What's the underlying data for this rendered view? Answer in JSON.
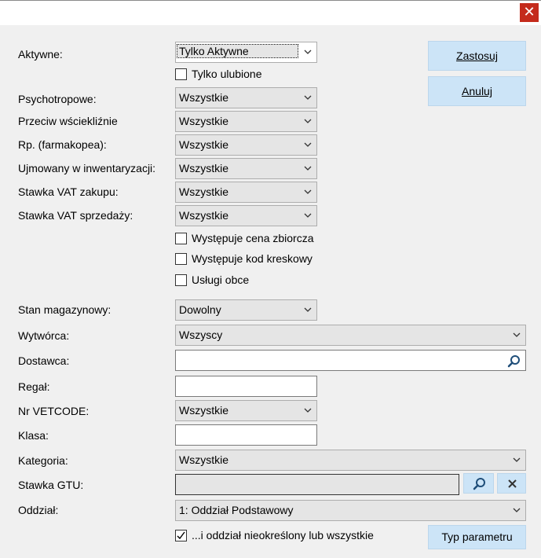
{
  "window": {
    "close_glyph": "✕"
  },
  "filters": {
    "aktywne": {
      "label": "Aktywne:",
      "value": "Tylko Aktywne"
    },
    "tylko_ulubione": {
      "label": "Tylko ulubione",
      "checked": false
    },
    "psychotropowe": {
      "label": "Psychotropowe:",
      "value": "Wszystkie"
    },
    "przeciw_wscieklizn": {
      "label": "Przeciw wściekliźnie",
      "value": "Wszystkie"
    },
    "rp_farmakopea": {
      "label": "Rp. (farmakopea):",
      "value": "Wszystkie"
    },
    "inwentaryzacja": {
      "label": "Ujmowany w inwentaryzacji:",
      "value": "Wszystkie"
    },
    "vat_zakupu": {
      "label": "Stawka VAT zakupu:",
      "value": "Wszystkie"
    },
    "vat_sprzedazy": {
      "label": "Stawka VAT sprzedaży:",
      "value": "Wszystkie"
    },
    "cena_zbiorcza": {
      "label": "Występuje cena zbiorcza",
      "checked": false
    },
    "kod_kreskowy": {
      "label": "Występuje kod kreskowy",
      "checked": false
    },
    "uslugi_obce": {
      "label": "Usługi obce",
      "checked": false
    },
    "stan_magazynowy": {
      "label": "Stan magazynowy:",
      "value": "Dowolny"
    },
    "wytworca": {
      "label": "Wytwórca:",
      "value": "Wszyscy"
    },
    "dostawca": {
      "label": "Dostawca:",
      "value": ""
    },
    "regal": {
      "label": "Regał:",
      "value": ""
    },
    "nr_vetcode": {
      "label": "Nr VETCODE:",
      "value": "Wszystkie"
    },
    "klasa": {
      "label": "Klasa:",
      "value": ""
    },
    "kategoria": {
      "label": "Kategoria:",
      "value": "Wszystkie"
    },
    "stawka_gtu": {
      "label": "Stawka GTU:",
      "value": ""
    },
    "oddzial": {
      "label": "Oddział:",
      "value": "1: Oddział Podstawowy"
    },
    "oddzial_nieokreslony": {
      "label": "...i oddział nieokreślony lub wszystkie",
      "checked": true
    }
  },
  "buttons": {
    "zastosuj": "Zastosuj",
    "anuluj": "Anuluj",
    "typ_parametru": "Typ parametru"
  },
  "icons": {
    "search": "magnifier-icon",
    "clear": "x-icon",
    "dropdown": "chevron-down-icon"
  },
  "colors": {
    "button_bg": "#cce4f7",
    "close_bg": "#c42b1c",
    "dialog_bg": "#f0f0f0"
  }
}
